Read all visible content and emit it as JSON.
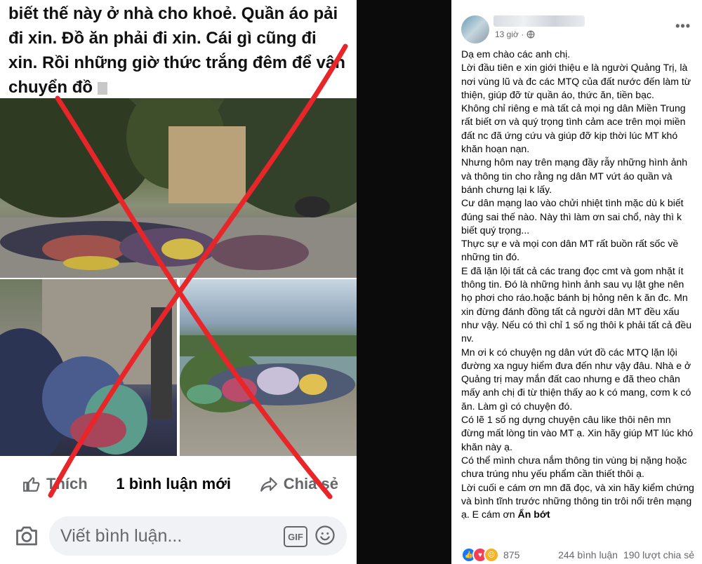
{
  "left_screenshot": {
    "post_text": "biết thế này ở nhà cho khoẻ. Quần áo pải đi xin. Đồ ăn phải đi xin. Cái gì cũng đi xin. Rồi những giờ thức trắng đêm để vận chuyển đồ",
    "like_label": "Thích",
    "new_comments_label": "1 bình luận mới",
    "share_label": "Chia sẻ",
    "comment_placeholder": "Viết bình luận...",
    "gif_label": "GIF"
  },
  "post": {
    "timestamp": "13 giờ ·",
    "more_icon": "more-horizontal-icon",
    "paragraphs": [
      "Dạ em chào các anh chị.",
      "Lời đầu tiên e xin giới thiệu e là người Quảng Trị, là nơi vùng lũ và đc các MTQ của đất nước đến làm từ thiện, giúp đỡ từ quần áo, thức ăn, tiền bạc.",
      "Không chỉ riêng e mà tất cả mọi ng dân Miền Trung rất biết ơn và quý trọng tình cảm ace trên mọi miền đất nc đã ứng cứu và giúp đỡ kịp thời lúc MT khó khăn hoạn nạn.",
      "Nhưng hôm nay trên mạng đầy rẫy những hình ảnh và thông tin cho rằng ng dân MT vứt áo quần và bánh chưng lại k lấy.",
      "Cư dân mạng lao vào chửi nhiệt tình mặc dù k biết đúng sai thế nào. Này thì làm ơn sai chổ, này thì k biết quý trọng...",
      "Thực sự e và mọi con dân MT rất buồn rất sốc về những tin đó.",
      "E đã lặn lội tất cả các trang đọc cmt và gom nhặt ít thông tin. Đó là những hình ảnh sau vụ lật ghe nên họ phơi cho ráo.hoặc bánh bị hỏng nên k ăn đc. Mn xin đừng đánh đồng tất cả người dân MT đều xấu như vậy. Nếu có thì chỉ 1 số ng thôi k phải tất cả đều nv.",
      "Mn ơi k có chuyện ng dân vứt đồ các MTQ lặn lội đường xa nguy hiểm đưa đến như vậy đâu. Nhà e ở Quảng trị may mắn đất cao nhưng e đã theo chân mấy anh chị đi từ thiện thấy ao k có mang, cơm k có ăn. Làm gì có chuyện đó.",
      "Có lẽ 1 số ng dựng chuyện câu like thôi nên mn đừng mất lòng tin vào MT ạ. Xin hãy giúp MT lúc khó khăn này ạ.",
      "Có thể mình chưa nắm thông tin vùng bị nặng hoặc chưa trúng nhu yếu phẩm cần thiết thôi ạ.",
      "Lời cuối e cám ơn mn đã đọc, và xin hãy kiểm chứng và bình tĩnh trước những thông tin trôi nổi trên mạng ạ. E cám ơn"
    ],
    "see_less": "Ẩn bớt",
    "reaction_count": "875",
    "comment_count": "244 bình luận",
    "share_count": "190 lượt chia sẻ"
  },
  "colors": {
    "x_mark": "#e8262a",
    "facebook_blue": "#1877f2",
    "love_red": "#f33e58",
    "haha_yellow": "#f7b125",
    "secondary_text": "#65676b"
  }
}
